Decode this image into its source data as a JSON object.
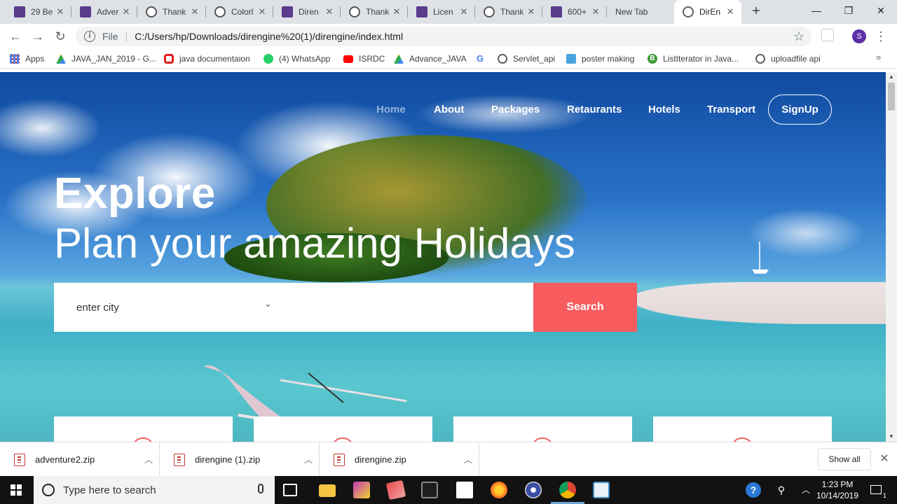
{
  "browser": {
    "tabs": [
      {
        "title": "29 Be",
        "favicon": "colorlib-icon"
      },
      {
        "title": "Adver",
        "favicon": "colorlib-icon"
      },
      {
        "title": "Thank",
        "favicon": "wordpress-icon"
      },
      {
        "title": "Colorl",
        "favicon": "wordpress-icon"
      },
      {
        "title": "Diren",
        "favicon": "colorlib-icon"
      },
      {
        "title": "Thank",
        "favicon": "wordpress-icon"
      },
      {
        "title": "Licen",
        "favicon": "colorlib-icon"
      },
      {
        "title": "Thank",
        "favicon": "wordpress-icon"
      },
      {
        "title": "600+",
        "favicon": "colorlib-icon"
      },
      {
        "title": "New Tab",
        "favicon": "none"
      },
      {
        "title": "DirEn",
        "favicon": "globe-icon",
        "active": true
      }
    ],
    "address": {
      "scheme": "File",
      "url": "C:/Users/hp/Downloads/direngine%20(1)/direngine/index.html"
    },
    "profile_initial": "S",
    "bookmarks": [
      {
        "label": "Apps",
        "icon": "apps-grid-icon"
      },
      {
        "label": "JAVA_JAN_2019 - G...",
        "icon": "google-drive-icon"
      },
      {
        "label": "java documentaion",
        "icon": "oracle-icon"
      },
      {
        "label": "(4) WhatsApp",
        "icon": "whatsapp-icon"
      },
      {
        "label": "ISRDC",
        "icon": "youtube-icon"
      },
      {
        "label": "Advance_JAVA",
        "icon": "google-drive-icon"
      },
      {
        "label": "",
        "icon": "google-icon"
      },
      {
        "label": "Servlet_api",
        "icon": "globe-icon"
      },
      {
        "label": "poster making",
        "icon": "bookmark-icon"
      },
      {
        "label": "ListIterator in Java...",
        "icon": "b-icon"
      },
      {
        "label": "uploadfile api",
        "icon": "globe-icon"
      }
    ]
  },
  "site": {
    "nav": [
      "Home",
      "About",
      "Packages",
      "Retaurants",
      "Hotels",
      "Transport"
    ],
    "signup": "SignUp",
    "hero_title": "Explore",
    "hero_subtitle": "Plan your amazing Holidays",
    "city_select": "enter city",
    "search_button": "Search"
  },
  "downloads": {
    "items": [
      "adventure2.zip",
      "direngine (1).zip",
      "direngine.zip"
    ],
    "show_all": "Show all"
  },
  "taskbar": {
    "search_placeholder": "Type here to search",
    "time": "1:23 PM",
    "date": "10/14/2019"
  },
  "colors": {
    "accent": "#f85c5e",
    "chrome_tabstrip": "#dee1e6",
    "taskbar": "#121212"
  }
}
